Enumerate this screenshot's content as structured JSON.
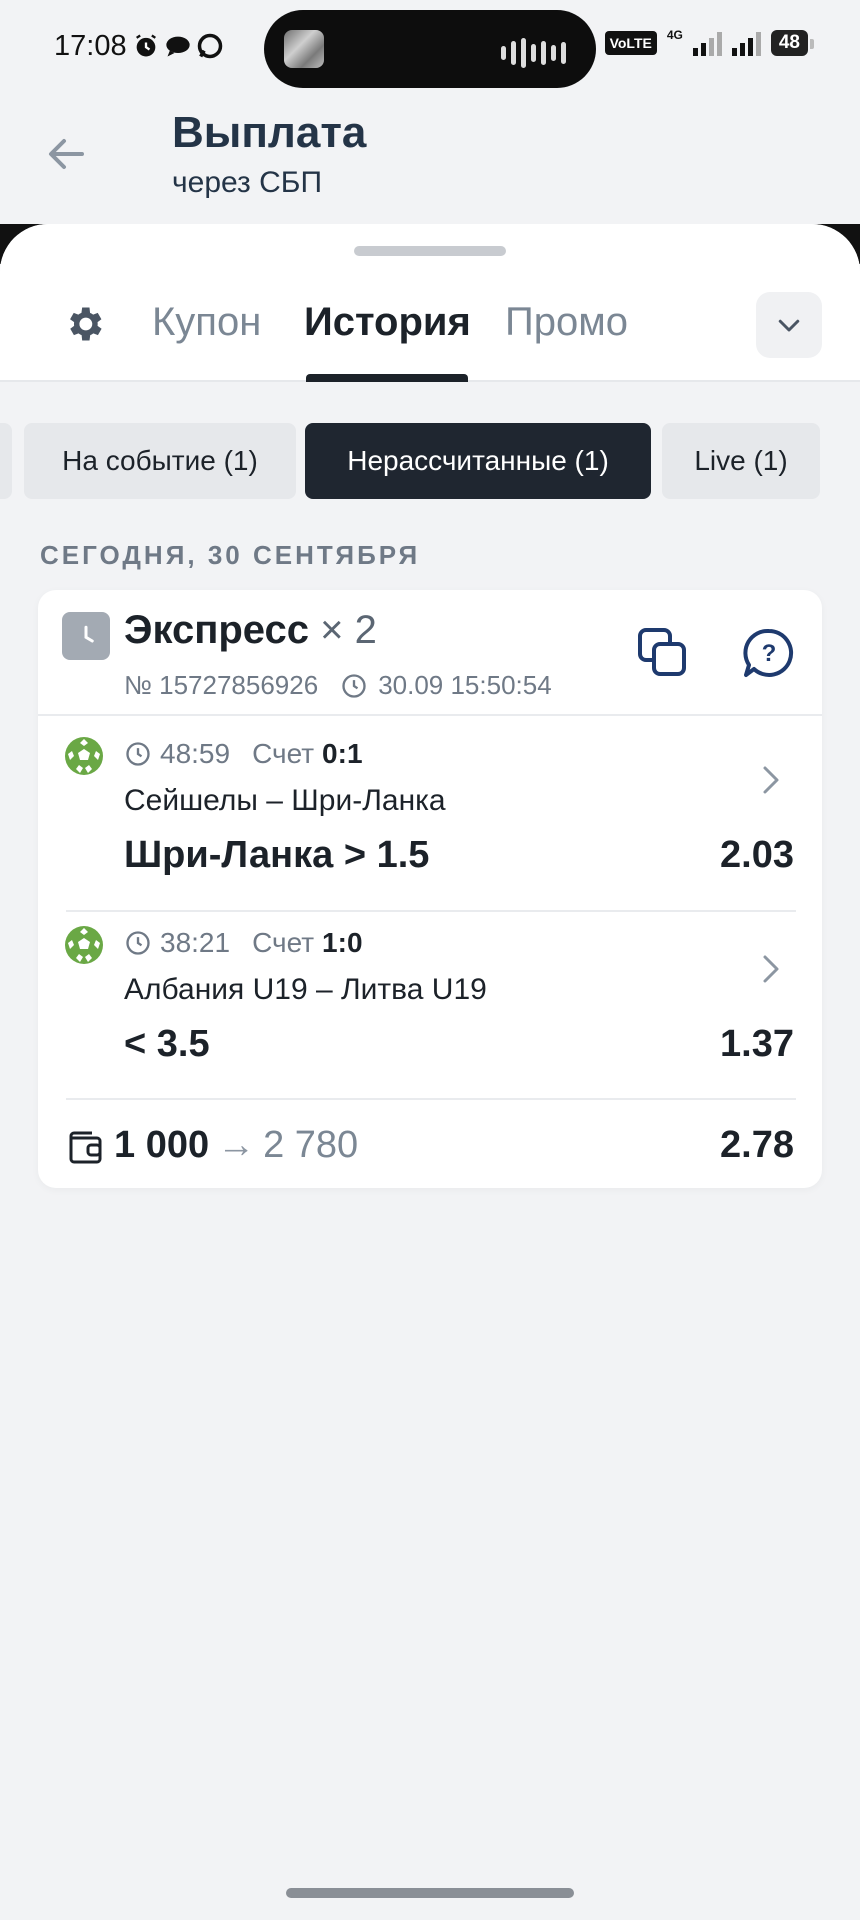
{
  "status_bar": {
    "time": "17:08",
    "volte": "VoLTE",
    "network": "4G",
    "battery": "48"
  },
  "header": {
    "title": "Выплата",
    "subtitle": "через СБП"
  },
  "sheet": {
    "tabs": [
      {
        "label": "Купон",
        "active": false
      },
      {
        "label": "История",
        "active": true
      },
      {
        "label": "Промо",
        "active": false
      }
    ],
    "filters": [
      {
        "label": "На событие (1)",
        "active": false
      },
      {
        "label": "Нерассчитанные (1)",
        "active": true
      },
      {
        "label": "Live (1)",
        "active": false
      }
    ],
    "date_label": "СЕГОДНЯ, 30 СЕНТЯБРЯ"
  },
  "bet": {
    "type": "Экспресс",
    "multiplier": "× 2",
    "number": "№ 15727856926",
    "datetime": "30.09 15:50:54",
    "events": [
      {
        "time": "48:59",
        "score_label": "Счет",
        "score": "0:1",
        "teams": "Сейшелы – Шри-Ланка",
        "selection": "Шри-Ланка > 1.5",
        "odds": "2.03"
      },
      {
        "time": "38:21",
        "score_label": "Счет",
        "score": "1:0",
        "teams": "Албания U19 – Литва U19",
        "selection": "< 3.5",
        "odds": "1.37"
      }
    ],
    "stake": "1 000",
    "arrow": "→",
    "payout": "2 780",
    "total_odds": "2.78"
  },
  "colors": {
    "background": "#f2f3f5",
    "active_chip": "#1f2630",
    "ball_green": "#6aa845",
    "text_primary": "#1c2229",
    "text_secondary": "#6f7986",
    "icon_blue": "#1e3a6e"
  }
}
